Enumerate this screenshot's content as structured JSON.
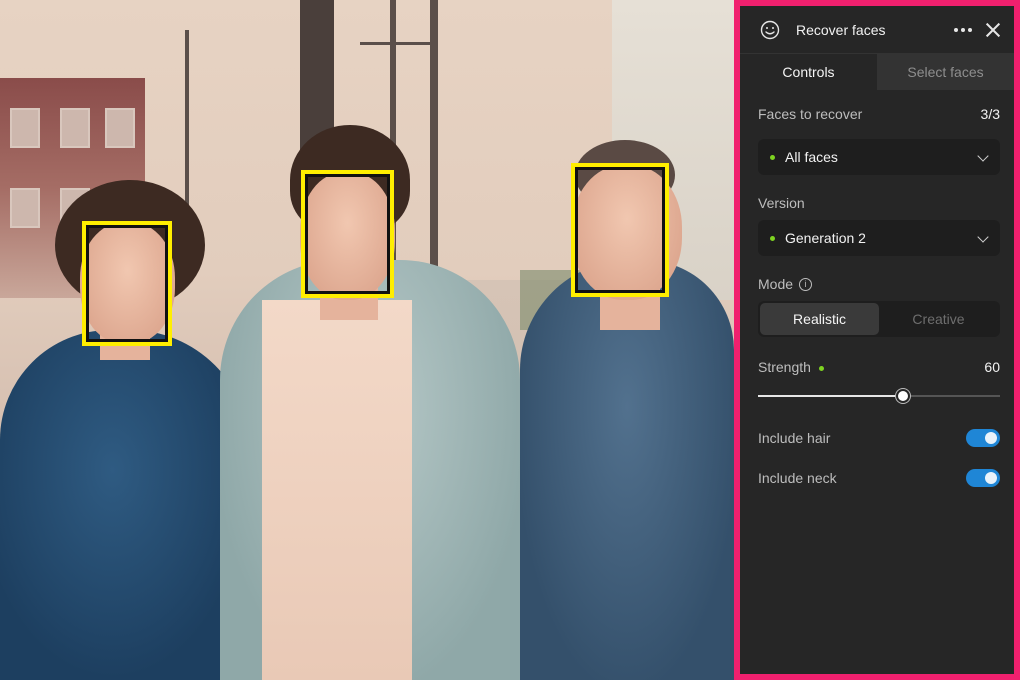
{
  "panel": {
    "title": "Recover faces",
    "icon": "smiley-face-icon",
    "tabs": [
      {
        "label": "Controls",
        "active": true
      },
      {
        "label": "Select faces",
        "active": false
      }
    ],
    "faces_to_recover": {
      "label": "Faces to recover",
      "value": "3/3"
    },
    "faces_select": {
      "value": "All faces"
    },
    "version": {
      "label": "Version",
      "value": "Generation 2"
    },
    "mode": {
      "label": "Mode",
      "options": [
        "Realistic",
        "Creative"
      ],
      "selected": "Realistic"
    },
    "strength": {
      "label": "Strength",
      "value": "60",
      "fraction": 0.6
    },
    "include_hair": {
      "label": "Include hair",
      "on": true
    },
    "include_neck": {
      "label": "Include neck",
      "on": true
    },
    "accent_color": "#f0206e",
    "dot_color": "#7ed321",
    "toggle_color": "#1f86d6"
  },
  "photo": {
    "detected_faces": 3,
    "box_color": "#ffee00"
  }
}
